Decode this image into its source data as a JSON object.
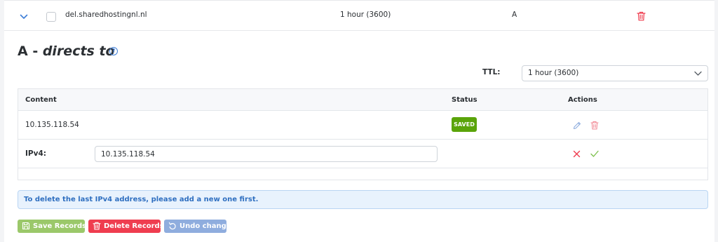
{
  "record": {
    "name": "del.sharedhostingnl.nl",
    "ttl": "1 hour (3600)",
    "type": "A"
  },
  "heading": {
    "prefix": "A - ",
    "italic": "directs to",
    "help_glyph": "?"
  },
  "ttl": {
    "label": "TTL:",
    "selected": "1 hour (3600)"
  },
  "table": {
    "headers": {
      "content": "Content",
      "status": "Status",
      "actions": "Actions"
    },
    "rows": [
      {
        "content": "10.135.118.54",
        "status": "SAVED"
      }
    ],
    "edit_row": {
      "label": "IPv4:",
      "value": "10.135.118.54"
    }
  },
  "info": {
    "message": "To delete the last IPv4 address, please add a new one first."
  },
  "buttons": {
    "save": "Save Recordset",
    "delete": "Delete Recordset",
    "undo": "Undo changes"
  },
  "colors": {
    "saved_badge": "#5aa40a",
    "delete_red": "#ef3d4f",
    "save_green": "#9bc86a",
    "undo_blue": "#8fadde",
    "info_text": "#2f6fc0",
    "link_blue": "#3f7fd8"
  },
  "icons": {
    "row_toggle": "chevron-down-icon",
    "row_delete": "trash-icon",
    "help": "help-circle-icon",
    "ttl_dropdown": "chevron-down-icon",
    "edit": "pencil-icon",
    "cancel": "close-icon",
    "confirm": "check-icon",
    "save": "save-icon",
    "delete": "trash-icon",
    "undo": "undo-icon"
  }
}
